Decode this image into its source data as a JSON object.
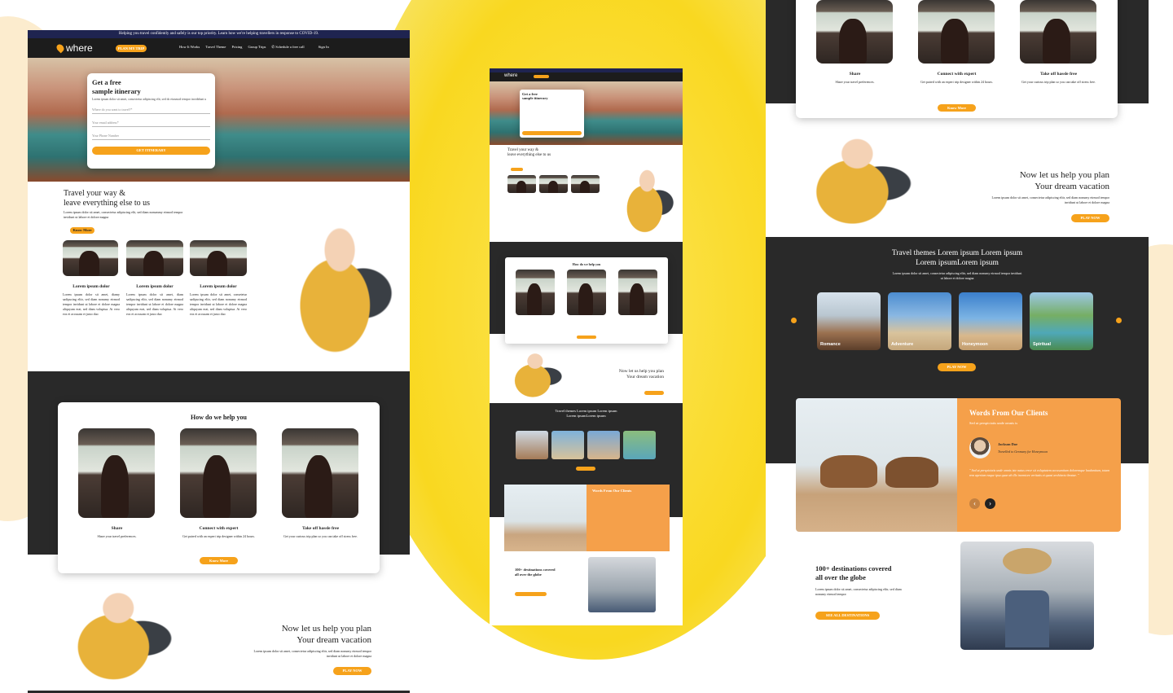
{
  "colors": {
    "accent": "#f6a21b",
    "dark": "#292929",
    "navy": "#1f2450",
    "client_orange": "#f5a04a",
    "bg_yellow": "#f9d820"
  },
  "announcement": "Helping you travel confidently and safely is our top priority. Learn how we're helping travellers in response to COVID-19.",
  "nav": {
    "logo_main": "where",
    "logo_sub": "TRAVEL DESIGN",
    "plan_button": "PLAN MY TRIP",
    "links": [
      "How It Works",
      "Travel Theme",
      "Pricing",
      "Group Trips"
    ],
    "schedule": "Schedule a free call",
    "signin": "Sign In",
    "phone_icon": "phone-icon"
  },
  "hero_form": {
    "title_line1": "Get a free",
    "title_line2": "sample itinerary",
    "desc": "Lorem ipsum dolor sit amet, consectetur adipiscing elit, sed do eiusmod tempor incididunt u",
    "field_destination": "Where do you want to travel?*",
    "field_email": "Your email address*",
    "field_phone": "Your Phone Number",
    "submit": "GET ITINERARY"
  },
  "travel_section": {
    "title_line1": "Travel your way &",
    "title_line2": "leave everything else to us",
    "desc": "Lorem ipsum dolor sit amet, consectetur adipiscing elit, sed diam nonummy eirmod tempor invidunt ut labore et dolore magna",
    "button": "Know More",
    "cards": [
      {
        "title": "Lorem ipsum dolor",
        "text": "Lorem ipsum dolor sit amet, diamy sadipscing elitr, sed diam nonumy eirmod tempor invidunt ut labore et dolore magna aliquyam erat, sed diam voluptua. At vero eos et accusam et justo duo"
      },
      {
        "title": "Lorem ipsum dolor",
        "text": "Lorem ipsum dolor sit amet, diam sadipscing elitr, sed diam nonumy eirmod tempor invidunt ut labore et dolore magna aliquyam erat, sed diam voluptua. At vero eos et accusam et justo duo"
      },
      {
        "title": "Lorem ipsum dolor",
        "text": "Lorem ipsum dolor sit amet, consetetur sadipscing elitr, sed diam nonumy eirmod tempor invidunt ut labore et dolore magna aliquyam erat, sed diam voluptua. At vero eos et accusam et justo duo"
      }
    ]
  },
  "help_section": {
    "title": "How do we help you",
    "items": [
      {
        "title": "Share",
        "text": "Share your travel preferences."
      },
      {
        "title": "Connect with expert",
        "text": "Get paired with an expert trip designer within 24 hours."
      },
      {
        "title": "Take off hassle free",
        "text": "Get your curious trip plan so you can take off stress free."
      }
    ],
    "button": "Know More"
  },
  "plan_section": {
    "title_line1": "Now let us help you plan",
    "title_line2": "Your dream vacation",
    "desc": "Lorem ipsum dolor sit amet, consectetur adipiscing elitr, sed diam nonumy eirmod tempor invidunt ut labore et dolore magna",
    "button": "PLAY NOW"
  },
  "themes_section": {
    "title_line1": "Travel themes Lorem ipsum Lorem ipsum",
    "title_line2": "Lorem ipsumLorem ipsum",
    "desc": "Lorem ipsum dolor sit amet, consectetur adipiscing elitr, sed diam nonumy eirmod tempor invidunt ut labore et dolore magna",
    "tiles": [
      "Romance",
      "Adventure",
      "Honeymoon",
      "Spiritual"
    ],
    "button": "PLAY NOW"
  },
  "clients_section": {
    "title": "Words From Our Clients",
    "subtitle": "Sed ut perspiciatis unde omnis is",
    "client_name": "Jackson Doe",
    "client_role": "Travelled to Germany for Honeymoon",
    "quote": "\" Sed ut perspiciatis unde omnis iste natus error sit voluptatem accusantium doloremque laudantium, totam rem aperiam eaque ipsa quae ab illo inventore veritatis et quasi architecto beatae. \"",
    "prev": "‹",
    "next": "›"
  },
  "destinations_section": {
    "title_line1": "100+ destinations covered",
    "title_line2": "all over the globe",
    "desc": "Lorem ipsum dolor sit amet, consectetur adipiscing elitr, sed diam nonumy eirmod tempor",
    "button": "SEE ALL DESTINATIONS"
  }
}
